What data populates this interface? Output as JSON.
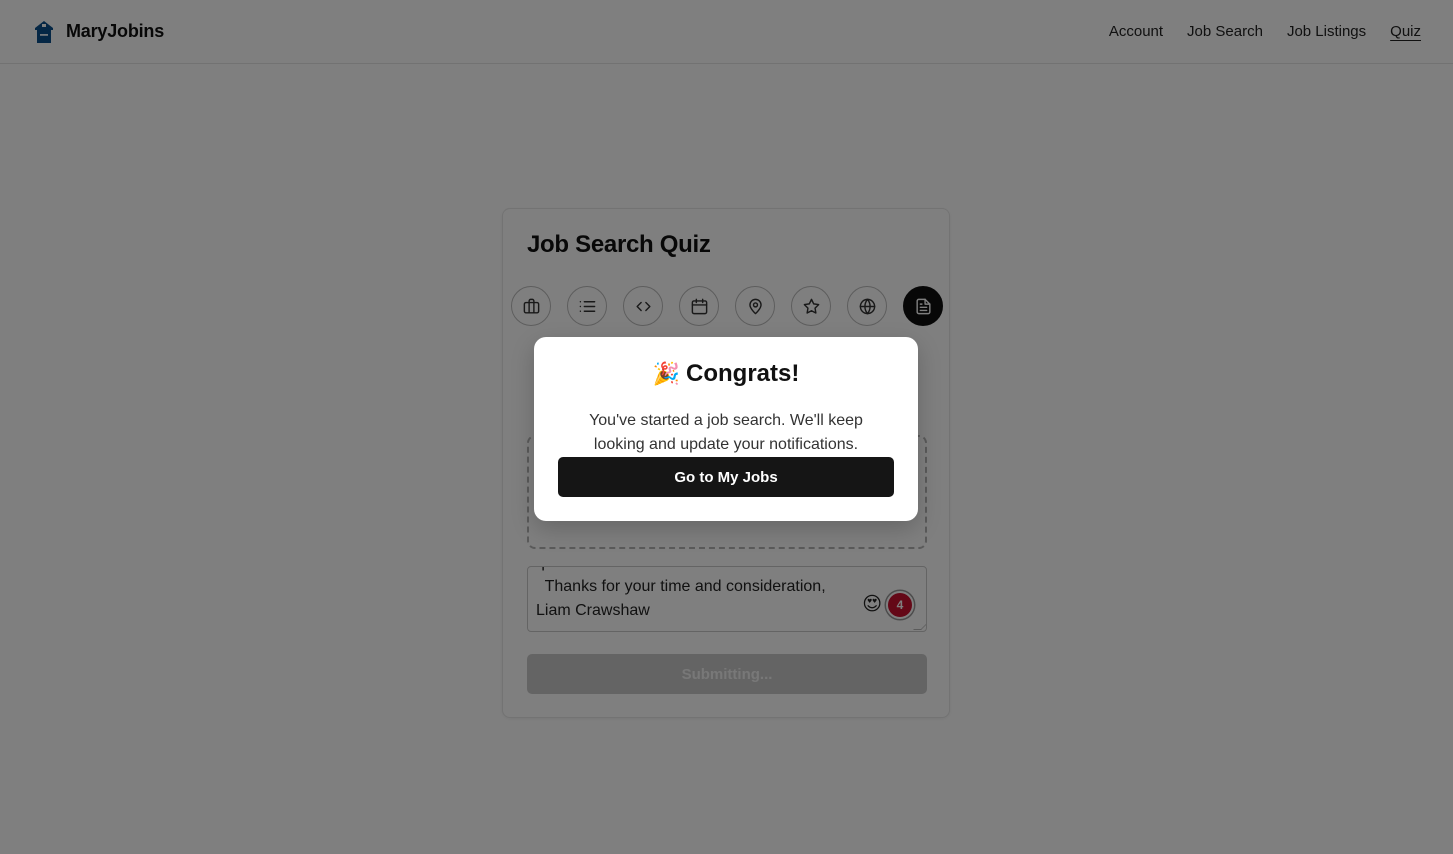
{
  "navbar": {
    "brand_name": "MaryJobins",
    "links": [
      {
        "label": "Account"
      },
      {
        "label": "Job Search"
      },
      {
        "label": "Job Listings"
      },
      {
        "label": "Quiz",
        "active": true
      }
    ]
  },
  "quiz": {
    "title": "Job Search Quiz",
    "steps": [
      {
        "icon": "briefcase-icon",
        "active": false
      },
      {
        "icon": "list-icon",
        "active": false
      },
      {
        "icon": "code-icon",
        "active": false
      },
      {
        "icon": "calendar-icon",
        "active": false
      },
      {
        "icon": "map-pin-icon",
        "active": false
      },
      {
        "icon": "star-icon",
        "active": false
      },
      {
        "icon": "globe-icon",
        "active": false
      },
      {
        "icon": "document-icon",
        "active": true
      }
    ],
    "cover_letter": {
      "partial_line": "qualifications.",
      "line1": "  Thanks for your time and consideration,",
      "line2": "Liam Crawshaw",
      "emoji": "😍",
      "badge_count": "4"
    },
    "submit_label": "Submitting..."
  },
  "modal": {
    "icon": "🎉",
    "title": "Congrats!",
    "message": "You've started a job search. We'll keep looking and update your notifications.",
    "button_label": "Go to My Jobs"
  },
  "colors": {
    "accent": "#0f0f0f",
    "logo": "#0b4f8a",
    "badge": "#c8102e",
    "overlay": "rgba(0,0,0,0.5)"
  }
}
